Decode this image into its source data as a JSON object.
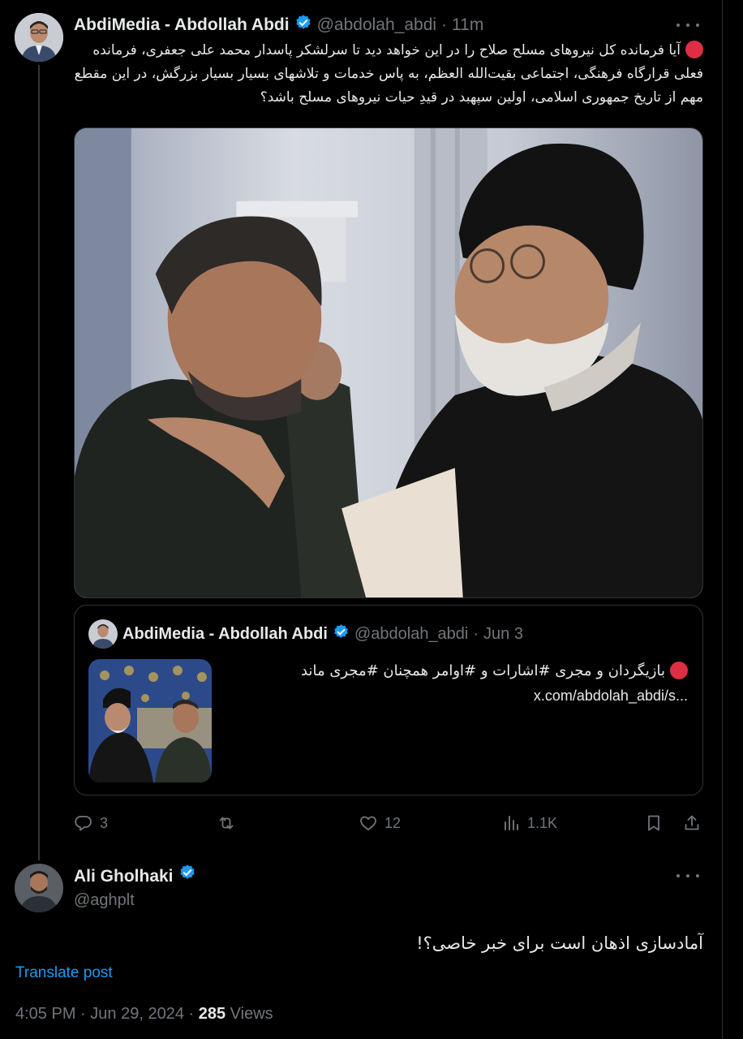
{
  "main_post": {
    "display_name": "AbdiMedia - Abdollah Abdi",
    "handle": "@abdolah_abdi",
    "separator": "·",
    "time": "11m",
    "text": "آیا فرمانده کل نیروهای مسلح صلاح را در این خواهد دید تا سرلشکر پاسدار محمد علی جعفری، فرمانده فعلی قرارگاه فرهنگی، اجتماعی بقیت‌الله العظم، به پاس خدمات و تلاشهای بسیار بسیار بزرگش، در این مقطع مهم از تاریخ جمهوری اسلامی، اولین سپهبد در قیدِ حیات نیروهای مسلح باشد؟"
  },
  "quoted_post": {
    "display_name": "AbdiMedia - Abdollah Abdi",
    "handle": "@abdolah_abdi",
    "separator": "·",
    "date": "Jun 3",
    "text": "بازیگردان و مجری #اشارات و #اوامر همچنان #مجری ماند",
    "link": "x.com/abdolah_abdi/s..."
  },
  "actions": {
    "replies": "3",
    "reposts": "",
    "likes": "12",
    "views": "1.1K"
  },
  "reply_post": {
    "display_name": "Ali Gholhaki",
    "handle": "@aghplt",
    "text": "آمادسازی اذهان است برای خبر خاصی؟!",
    "translate_label": "Translate post",
    "time": "4:05 PM",
    "separator": "·",
    "date": "Jun 29, 2024",
    "views_count": "285",
    "views_label": "Views"
  },
  "colors": {
    "background": "#000000",
    "text": "#e7e9ea",
    "muted": "#71767b",
    "link": "#1d9bf0",
    "verified": "#1d9bf0",
    "red_dot": "#dd2e44",
    "border": "#2f3336"
  },
  "icons": [
    "verified-badge-icon",
    "more-icon",
    "reply-icon",
    "repost-icon",
    "like-icon",
    "views-icon",
    "bookmark-icon",
    "share-icon",
    "red-circle-icon"
  ]
}
